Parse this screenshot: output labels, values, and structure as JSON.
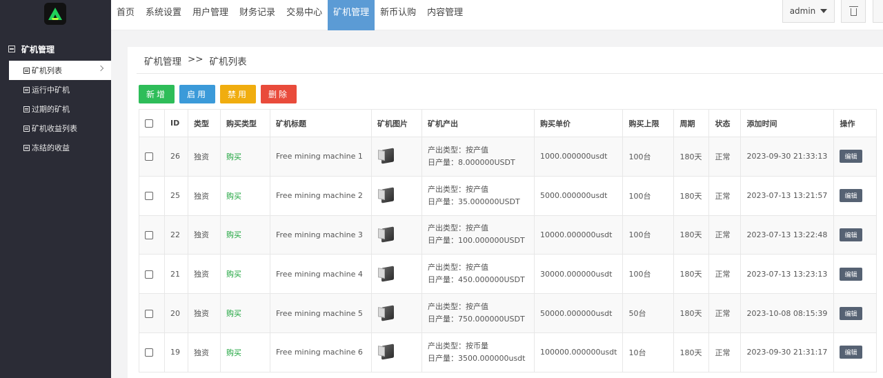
{
  "sidebar": {
    "section_title": "矿机管理",
    "items": [
      {
        "label": "矿机列表",
        "active": true
      },
      {
        "label": "运行中矿机"
      },
      {
        "label": "过期的矿机"
      },
      {
        "label": "矿机收益列表"
      },
      {
        "label": "冻结的收益"
      }
    ]
  },
  "topnav": {
    "items": [
      "首页",
      "系统设置",
      "用户管理",
      "财务记录",
      "交易中心",
      "矿机管理",
      "新币认购",
      "内容管理"
    ],
    "active_index": 5,
    "user": "admin"
  },
  "breadcrumb": {
    "root": "矿机管理",
    "sep": ">>",
    "current": "矿机列表"
  },
  "actions": {
    "add": "新增",
    "enable": "启用",
    "disable": "禁用",
    "delete": "删除"
  },
  "table": {
    "headers": [
      "ID",
      "类型",
      "购买类型",
      "矿机标题",
      "矿机图片",
      "矿机产出",
      "购买单价",
      "购买上限",
      "周期",
      "状态",
      "添加时间",
      "操作"
    ],
    "rows": [
      {
        "id": "26",
        "type": "独资",
        "buy_type": "购买",
        "title": "Free mining machine 1",
        "out_type": "产出类型：按产值",
        "out_daily": "日产量：8.000000USDT",
        "price": "1000.000000usdt",
        "limit": "100台",
        "cycle": "180天",
        "status": "正常",
        "time": "2023-09-30 21:33:13",
        "op": "编辑"
      },
      {
        "id": "25",
        "type": "独资",
        "buy_type": "购买",
        "title": "Free mining machine 2",
        "out_type": "产出类型：按产值",
        "out_daily": "日产量：35.000000USDT",
        "price": "5000.000000usdt",
        "limit": "100台",
        "cycle": "180天",
        "status": "正常",
        "time": "2023-07-13 13:21:57",
        "op": "编辑"
      },
      {
        "id": "22",
        "type": "独资",
        "buy_type": "购买",
        "title": "Free mining machine 3",
        "out_type": "产出类型：按产值",
        "out_daily": "日产量：100.000000USDT",
        "price": "10000.000000usdt",
        "limit": "100台",
        "cycle": "180天",
        "status": "正常",
        "time": "2023-07-13 13:22:48",
        "op": "编辑"
      },
      {
        "id": "21",
        "type": "独资",
        "buy_type": "购买",
        "title": "Free mining machine 4",
        "out_type": "产出类型：按产值",
        "out_daily": "日产量：450.000000USDT",
        "price": "30000.000000usdt",
        "limit": "100台",
        "cycle": "180天",
        "status": "正常",
        "time": "2023-07-13 13:23:13",
        "op": "编辑"
      },
      {
        "id": "20",
        "type": "独资",
        "buy_type": "购买",
        "title": "Free mining machine 5",
        "out_type": "产出类型：按产值",
        "out_daily": "日产量：750.000000USDT",
        "price": "50000.000000usdt",
        "limit": "50台",
        "cycle": "180天",
        "status": "正常",
        "time": "2023-10-08 08:15:39",
        "op": "编辑"
      },
      {
        "id": "19",
        "type": "独资",
        "buy_type": "购买",
        "title": "Free mining machine 6",
        "out_type": "产出类型：按币量",
        "out_daily": "日产量：3500.000000usdt",
        "price": "100000.000000usdt",
        "limit": "10台",
        "cycle": "180天",
        "status": "正常",
        "time": "2023-09-30 21:31:17",
        "op": "编辑"
      }
    ]
  },
  "colors": {
    "sidebar_bg": "#2b2c36",
    "nav_active": "#5b9bd5",
    "buy_green": "#1aa33a",
    "edit_btn": "#566273"
  }
}
